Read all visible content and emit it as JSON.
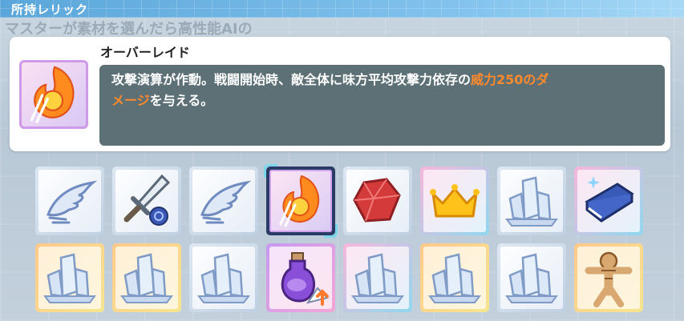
{
  "header": {
    "title": "所持レリック"
  },
  "background": {
    "faded_text": "マスターが素材を選んだら高性能AIの"
  },
  "detail": {
    "name": "オーバーレイド",
    "icon": "fire-sword-icon",
    "description_part1": "攻撃演算が作動。戦闘開始時、敵全体に味方平均攻撃力依存の",
    "description_highlight1": "威力250のダ",
    "description_highlight2": "メージ",
    "description_part2": "を与える。"
  },
  "colors": {
    "header": "#5aa6da",
    "description_bg": "#5c7075",
    "highlight": "#ff8a2e",
    "selected_corner": "#7bd8ea"
  },
  "relics": [
    {
      "row": 1,
      "icon": "wing-icon",
      "rarity": "common",
      "selected": false
    },
    {
      "row": 1,
      "icon": "sword-icon",
      "rarity": "common",
      "selected": false
    },
    {
      "row": 1,
      "icon": "wing-icon",
      "rarity": "common",
      "selected": false
    },
    {
      "row": 1,
      "icon": "fire-sword-icon",
      "rarity": "epic",
      "selected": true
    },
    {
      "row": 1,
      "icon": "ruby-icon",
      "rarity": "common",
      "selected": false
    },
    {
      "row": 1,
      "icon": "crown-icon",
      "rarity": "rare",
      "selected": false
    },
    {
      "row": 1,
      "icon": "crystal-icon",
      "rarity": "common",
      "selected": false
    },
    {
      "row": 1,
      "icon": "book-icon",
      "rarity": "rare",
      "selected": false
    },
    {
      "row": 2,
      "icon": "crystal-icon",
      "rarity": "gold",
      "selected": false
    },
    {
      "row": 2,
      "icon": "crystal-icon",
      "rarity": "gold",
      "selected": false
    },
    {
      "row": 2,
      "icon": "crystal-icon",
      "rarity": "common",
      "selected": false
    },
    {
      "row": 2,
      "icon": "potion-icon",
      "rarity": "epic",
      "selected": false
    },
    {
      "row": 2,
      "icon": "crystal-icon",
      "rarity": "rare",
      "selected": false
    },
    {
      "row": 2,
      "icon": "crystal-icon",
      "rarity": "gold",
      "selected": false
    },
    {
      "row": 2,
      "icon": "crystal-icon",
      "rarity": "common",
      "selected": false
    },
    {
      "row": 2,
      "icon": "straw-doll-icon",
      "rarity": "gold",
      "selected": false
    }
  ]
}
